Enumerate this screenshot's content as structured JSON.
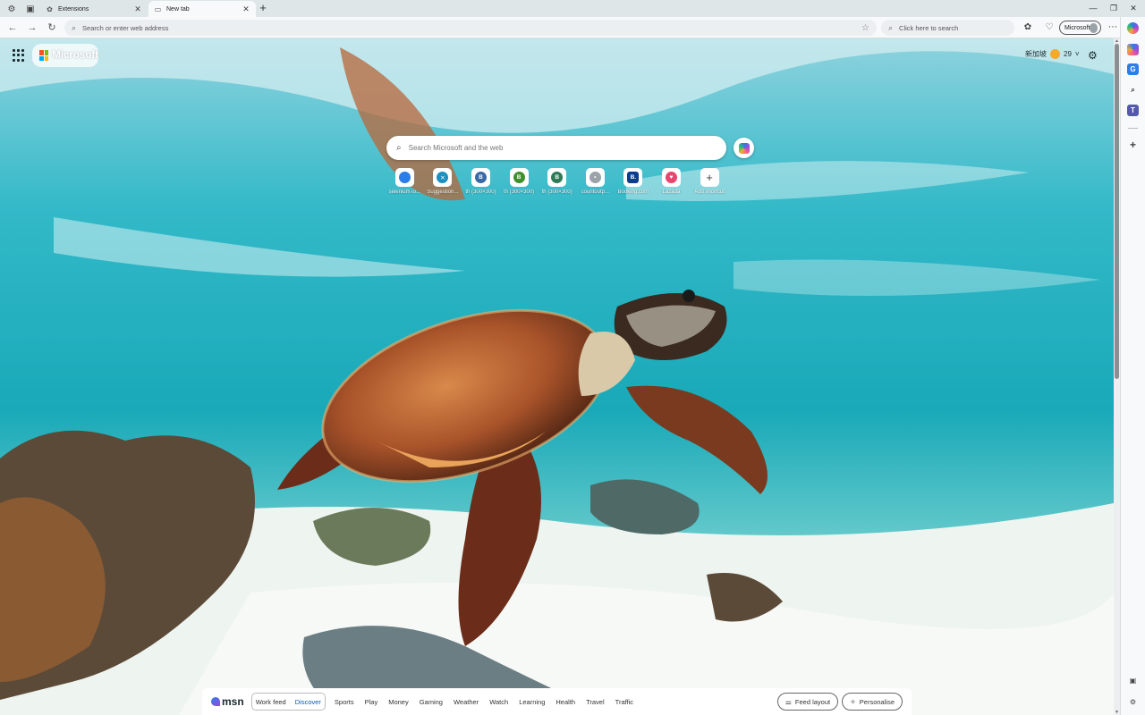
{
  "tabs": [
    {
      "label": "Extensions"
    },
    {
      "label": "New tab"
    }
  ],
  "toolbar": {
    "address_placeholder": "Search or enter web address",
    "search_placeholder": "Click here to search",
    "profile_label": "Microsoft"
  },
  "ntp": {
    "brand": "Microsoft",
    "weather_location": "新加坡",
    "weather_temp": "29",
    "search_placeholder": "Search Microsoft and the web"
  },
  "shortcuts": [
    {
      "label": "seleniumTo...",
      "letter": "",
      "color": "#2b7de9"
    },
    {
      "label": "Suggestion...",
      "letter": "",
      "color": "#1e90c0"
    },
    {
      "label": "th (300×300)",
      "letter": "B",
      "color": "#3a6aa5"
    },
    {
      "label": "th (300×300)",
      "letter": "B",
      "color": "#3f8f2e"
    },
    {
      "label": "th (300×300)",
      "letter": "B",
      "color": "#2f7a57"
    },
    {
      "label": "countoutp...",
      "letter": "•",
      "color": "#9aa3a8"
    },
    {
      "label": "Booking.com",
      "letter": "B.",
      "color": "#0b3d8c"
    },
    {
      "label": "Lazada",
      "letter": "♥",
      "color": "#e8466e"
    },
    {
      "label": "Add shortcut",
      "letter": "+",
      "color": "#ffffff"
    }
  ],
  "feed": {
    "logo": "msn",
    "toggle": [
      "Work feed",
      "Discover"
    ],
    "active_toggle": "Discover",
    "nav": [
      "Sports",
      "Play",
      "Money",
      "Gaming",
      "Weather",
      "Watch",
      "Learning",
      "Health",
      "Travel",
      "Traffic"
    ],
    "feed_layout_label": "Feed layout",
    "personalise_label": "Personalise"
  }
}
